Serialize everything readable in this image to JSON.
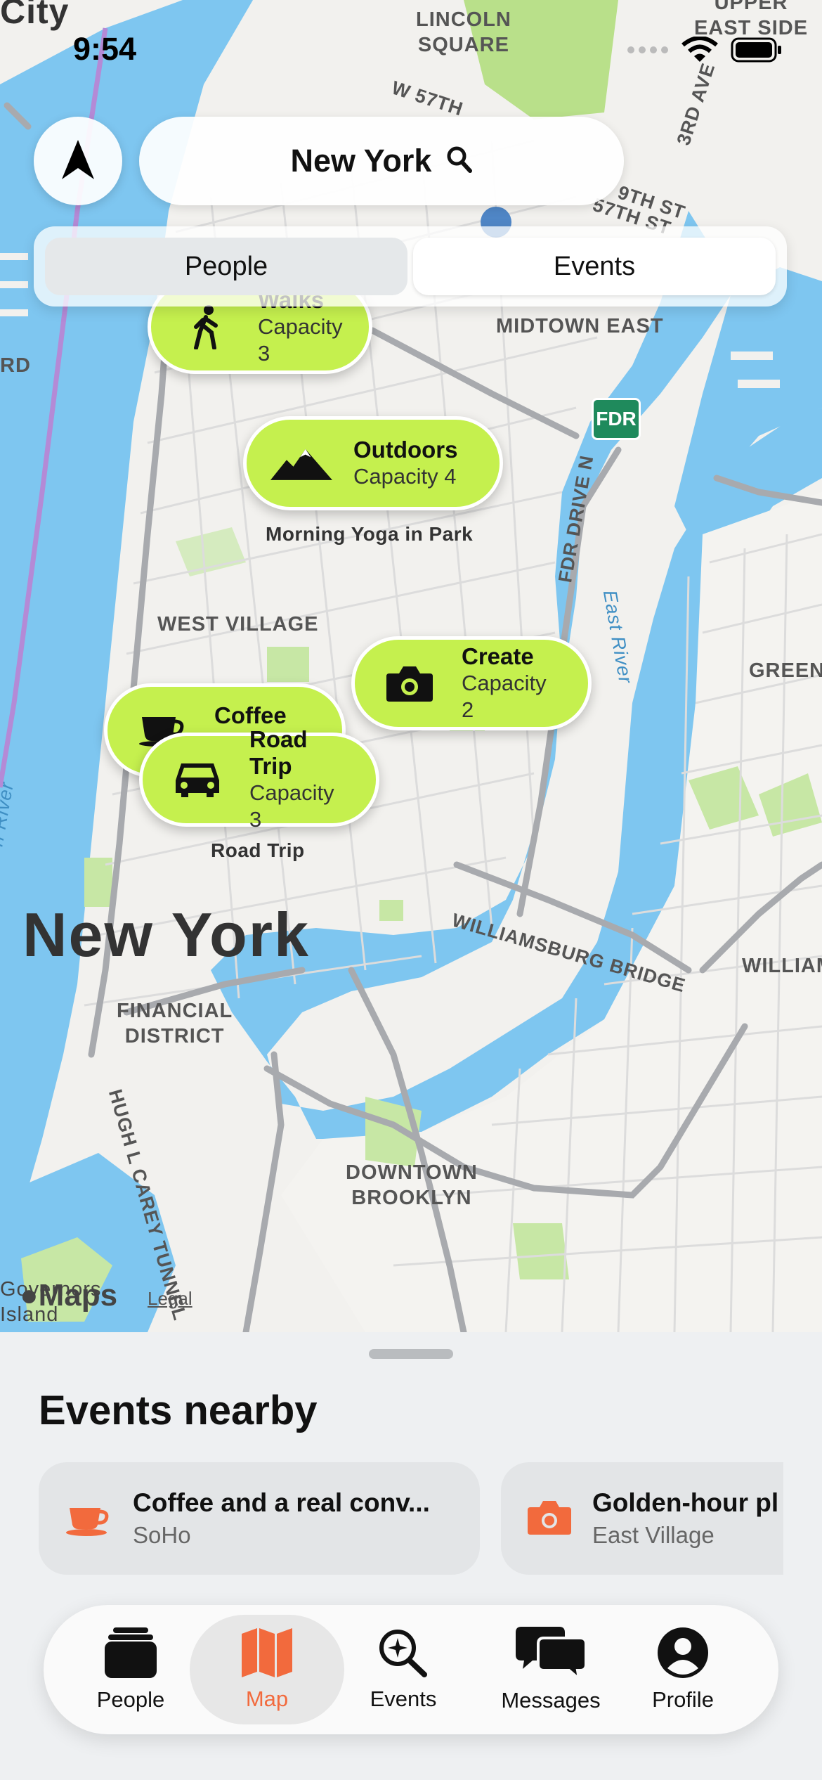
{
  "status_bar": {
    "time": "9:54"
  },
  "header": {
    "search_city": "New York",
    "segments": [
      {
        "label": "People",
        "selected": false
      },
      {
        "label": "Events",
        "selected": true
      }
    ]
  },
  "map": {
    "labels": {
      "city_corner": "City",
      "lincoln_square": "LINCOLN\nSQUARE",
      "upper_east_side": "UPPER\nEAST SIDE",
      "w57": "W 57TH",
      "third_ave": "3RD AVE",
      "ninth_st": "9TH ST",
      "th57": "57TH ST",
      "midtown_east": "MIDTOWN EAST",
      "rd_fragment": "RD",
      "fdr_shield": "FDR",
      "fdr_drive": "FDR DRIVE N",
      "east_river": "East River",
      "west_village": "WEST VILLAGE",
      "greenpoint": "GREENP",
      "river_fragment": "n River",
      "new_york": "New York",
      "williamsburg_bridge": "WILLIAMSBURG BRIDGE",
      "william_fragment": "WILLIAM",
      "financial_district": "FINANCIAL\nDISTRICT",
      "hugh_carey": "HUGH L CAREY TUNNEL",
      "downtown_brooklyn": "DOWNTOWN\nBROOKLYN",
      "governors_island": "Governors\nIsland",
      "morning_yoga": "Morning Yoga in Park",
      "road_trip_label": "Road Trip"
    },
    "pins": [
      {
        "title": "Walks",
        "subtitle": "Capacity 3",
        "icon": "walking-person-icon"
      },
      {
        "title": "Outdoors",
        "subtitle": "Capacity 4",
        "icon": "mountains-icon"
      },
      {
        "title": "Create",
        "subtitle": "Capacity 2",
        "icon": "camera-icon"
      },
      {
        "title": "Coffee",
        "subtitle": "",
        "icon": "coffee-cup-icon"
      },
      {
        "title": "Road Trip",
        "subtitle": "Capacity 3",
        "icon": "car-icon"
      }
    ],
    "attribution": {
      "maps": "Maps",
      "legal": "Legal"
    }
  },
  "sheet": {
    "title": "Events nearby",
    "cards": [
      {
        "title": "Coffee and a real conv...",
        "subtitle": "SoHo",
        "icon": "coffee-cup-icon"
      },
      {
        "title": "Golden-hour pl",
        "subtitle": "East Village",
        "icon": "camera-icon"
      }
    ]
  },
  "tabbar": {
    "tabs": [
      {
        "label": "People",
        "icon": "people-cards-icon",
        "active": false
      },
      {
        "label": "Map",
        "icon": "map-icon",
        "active": true
      },
      {
        "label": "Events",
        "icon": "search-sparkle-icon",
        "active": false
      },
      {
        "label": "Messages",
        "icon": "chat-bubbles-icon",
        "active": false
      },
      {
        "label": "Profile",
        "icon": "profile-icon",
        "active": false
      }
    ]
  },
  "colors": {
    "pin_fill": "#c5f04e",
    "accent": "#f26a3d",
    "water": "#7ec6f0",
    "land": "#f2f1ee",
    "park": "#b9e08a"
  }
}
